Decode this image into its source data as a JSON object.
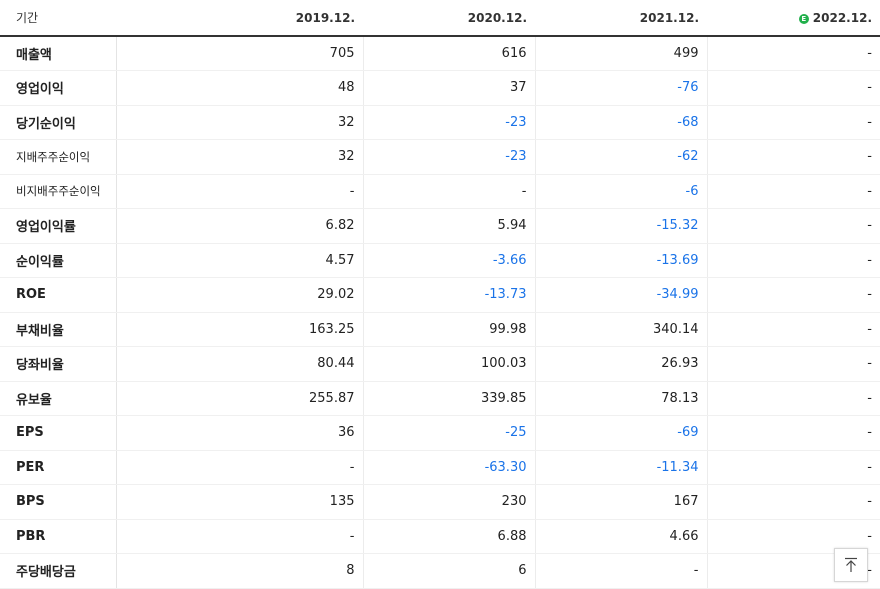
{
  "header": {
    "period_label": "기간",
    "columns": [
      "2019.12.",
      "2020.12.",
      "2021.12.",
      "2022.12."
    ],
    "estimate_icon": "estimate-e-icon",
    "estimate_color": "#21b04b"
  },
  "rows": [
    {
      "label": "매출액",
      "values": [
        "705",
        "616",
        "499",
        "-"
      ]
    },
    {
      "label": "영업이익",
      "values": [
        "48",
        "37",
        "-76",
        "-"
      ]
    },
    {
      "label": "당기순이익",
      "values": [
        "32",
        "-23",
        "-68",
        "-"
      ]
    },
    {
      "label": "지배주주순이익",
      "values": [
        "32",
        "-23",
        "-62",
        "-"
      ]
    },
    {
      "label": "비지배주주순이익",
      "values": [
        "-",
        "-",
        "-6",
        "-"
      ]
    },
    {
      "label": "영업이익률",
      "values": [
        "6.82",
        "5.94",
        "-15.32",
        "-"
      ]
    },
    {
      "label": "순이익률",
      "values": [
        "4.57",
        "-3.66",
        "-13.69",
        "-"
      ]
    },
    {
      "label": "ROE",
      "values": [
        "29.02",
        "-13.73",
        "-34.99",
        "-"
      ]
    },
    {
      "label": "부채비율",
      "values": [
        "163.25",
        "99.98",
        "340.14",
        "-"
      ]
    },
    {
      "label": "당좌비율",
      "values": [
        "80.44",
        "100.03",
        "26.93",
        "-"
      ]
    },
    {
      "label": "유보율",
      "values": [
        "255.87",
        "339.85",
        "78.13",
        "-"
      ]
    },
    {
      "label": "EPS",
      "values": [
        "36",
        "-25",
        "-69",
        "-"
      ]
    },
    {
      "label": "PER",
      "values": [
        "-",
        "-63.30",
        "-11.34",
        "-"
      ]
    },
    {
      "label": "BPS",
      "values": [
        "135",
        "230",
        "167",
        "-"
      ]
    },
    {
      "label": "PBR",
      "values": [
        "-",
        "6.88",
        "4.66",
        "-"
      ]
    },
    {
      "label": "주당배당금",
      "values": [
        "8",
        "6",
        "-",
        "-"
      ]
    }
  ],
  "colors": {
    "negative": "#1a73e8",
    "header_border": "#333333"
  },
  "scroll_top_icon": "arrow-up-to-top-icon"
}
